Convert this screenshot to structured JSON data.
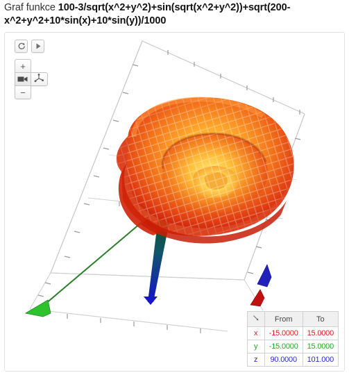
{
  "title": {
    "prefix": "Graf funkce ",
    "formula": "100-3/sqrt(x^2+y^2)+sin(sqrt(x^2+y^2))+sqrt(200-x^2+y^2+10*sin(x)+10*sin(y))/1000"
  },
  "toolbar": {
    "reset_label": "reset-view",
    "play_label": "play",
    "zoom_in_label": "+",
    "zoom_out_label": "−",
    "camera_label": "camera",
    "rotate_label": "rotate-3d"
  },
  "range_table": {
    "headers": [
      "",
      "From",
      "To"
    ],
    "corner_glyph": "↖",
    "rows": [
      {
        "axis": "x",
        "from": "-15.0000",
        "to": "15.0000",
        "color": "#d42020"
      },
      {
        "axis": "y",
        "from": "-15.0000",
        "to": "15.0000",
        "color": "#22a822"
      },
      {
        "axis": "z",
        "from": "90.0000",
        "to": "101.000",
        "color": "#2a2ad0"
      }
    ]
  },
  "plot": {
    "axes": [
      {
        "name": "x-axis",
        "color": "#cc1111"
      },
      {
        "name": "y-axis",
        "color": "#22aa22"
      },
      {
        "name": "z-axis",
        "color": "#1111cc"
      }
    ],
    "surface_colors": [
      "#ffe066",
      "#ffb327",
      "#f07818",
      "#e04010",
      "#c01808"
    ],
    "bbox_color": "#bfbfbf",
    "background": "#ffffff"
  },
  "chart_data": {
    "type": "surface3d",
    "title": "Graf funkce 100-3/sqrt(x^2+y^2)+sin(sqrt(x^2+y^2))+sqrt(200-x^2+y^2+10*sin(x)+10*sin(y))/1000",
    "expression": "100-3/sqrt(x^2+y^2)+sin(sqrt(x^2+y^2))+sqrt(200-x^2+y^2+10*sin(x)+10*sin(y))/1000",
    "xlabel": "x",
    "ylabel": "y",
    "zlabel": "z",
    "xlim": [
      -15.0,
      15.0
    ],
    "ylim": [
      -15.0,
      15.0
    ],
    "zlim": [
      90.0,
      101.0
    ],
    "grid": true,
    "legend": "none",
    "colormap": [
      "#ffe066",
      "#ffb327",
      "#f07818",
      "#e04010",
      "#c01808"
    ]
  }
}
